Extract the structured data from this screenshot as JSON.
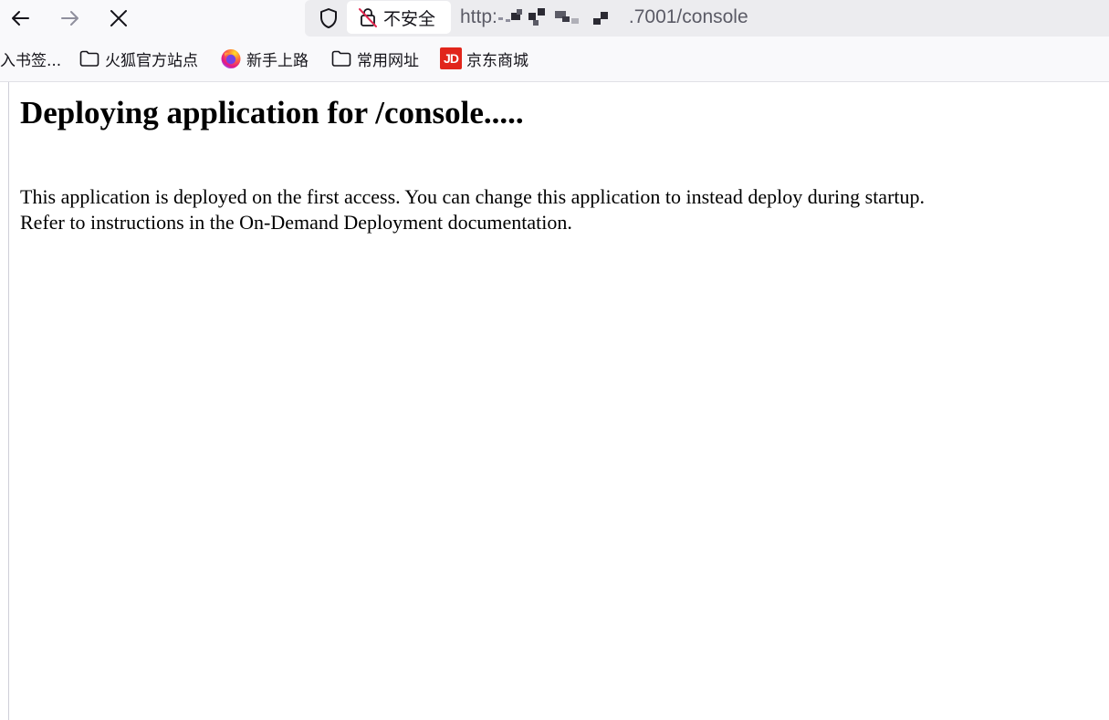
{
  "toolbar": {
    "back_icon": "arrow-left-icon",
    "forward_icon": "arrow-right-icon",
    "stop_icon": "close-icon",
    "colors": {
      "icon_enabled": "#15141a",
      "icon_disabled": "#8f8f9d",
      "insecure_slash": "#e22850"
    }
  },
  "urlbar": {
    "tracking_icon": "shield-icon",
    "security_label": "不安全",
    "url_prefix": "http:",
    "url_suffix": ".7001/console"
  },
  "bookmarks": [
    {
      "label": "入书签...",
      "icon": ""
    },
    {
      "label": "火狐官方站点",
      "icon": "folder-icon"
    },
    {
      "label": "新手上路",
      "icon": "firefox-icon"
    },
    {
      "label": "常用网址",
      "icon": "folder-icon"
    },
    {
      "label": "京东商城",
      "icon": "jd-logo-icon",
      "logo_text": "JD"
    }
  ],
  "page": {
    "heading": "Deploying application for /console.....",
    "line1": "This application is deployed on the first access. You can change this application to instead deploy during startup.",
    "line2": "Refer to instructions in the On-Demand Deployment documentation."
  }
}
